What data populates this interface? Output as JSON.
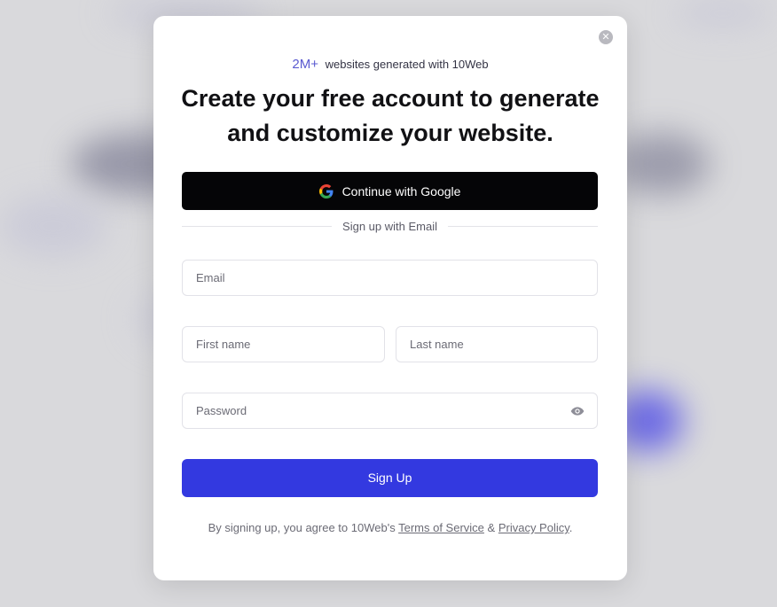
{
  "stat": {
    "number": "2M+",
    "text": "websites generated with 10Web"
  },
  "headline": {
    "line1": "Create your free account to generate",
    "line2": "and customize your website."
  },
  "google_button": {
    "label": "Continue with Google",
    "icon": "google-icon"
  },
  "divider": {
    "label": "Sign up with Email"
  },
  "form": {
    "email_placeholder": "Email",
    "email_value": "",
    "first_name_placeholder": "First name",
    "first_name_value": "",
    "last_name_placeholder": "Last name",
    "last_name_value": "",
    "password_placeholder": "Password",
    "password_value": "",
    "password_toggle_icon": "eye-icon"
  },
  "signup_button": {
    "label": "Sign Up"
  },
  "legal": {
    "prefix": "By signing up, you agree to 10Web's",
    "terms_link": "Terms of Service",
    "and": "&",
    "privacy_link": "Privacy Policy",
    "suffix": "."
  },
  "close_icon": "close-icon",
  "colors": {
    "accent": "#3339e0",
    "google_button_bg": "#050507",
    "stat_number": "#5a5ad0"
  }
}
